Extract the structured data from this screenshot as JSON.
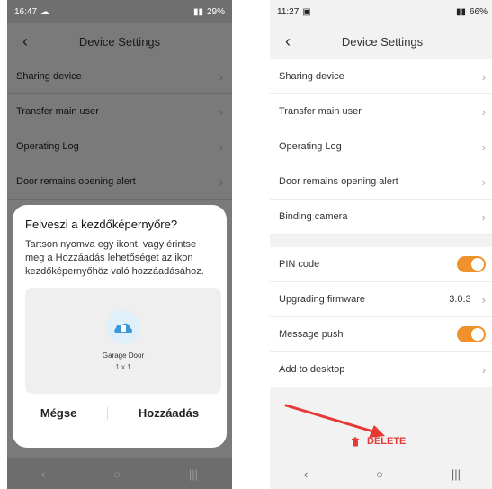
{
  "left": {
    "status": {
      "time": "16:47",
      "battery": "29%"
    },
    "header": {
      "title": "Device Settings"
    },
    "rows": [
      {
        "label": "Sharing device"
      },
      {
        "label": "Transfer main user"
      },
      {
        "label": "Operating Log"
      },
      {
        "label": "Door remains opening alert"
      }
    ],
    "dialog": {
      "title": "Felveszi a kezdőképernyőre?",
      "body": "Tartson nyomva egy ikont, vagy érintse meg a Hozzáadás lehetőséget az ikon kezdőképernyőhöz való hozzáadásához.",
      "preview_name": "Garage Door",
      "preview_size": "1 x 1",
      "cancel_label": "Mégse",
      "add_label": "Hozzáadás"
    }
  },
  "right": {
    "status": {
      "time": "11:27",
      "battery": "66%"
    },
    "header": {
      "title": "Device Settings"
    },
    "group1": [
      {
        "label": "Sharing device"
      },
      {
        "label": "Transfer main user"
      },
      {
        "label": "Operating Log"
      },
      {
        "label": "Door remains opening alert"
      },
      {
        "label": "Binding camera"
      }
    ],
    "pin": {
      "label": "PIN code",
      "enabled": true
    },
    "firmware": {
      "label": "Upgrading firmware",
      "version": "3.0.3"
    },
    "push": {
      "label": "Message push",
      "enabled": true
    },
    "desktop": {
      "label": "Add to desktop"
    },
    "delete_label": "DELETE"
  },
  "colors": {
    "accent": "#f0922b",
    "danger": "#e53935",
    "arrow": "#e53935"
  },
  "icons": {
    "back": "chevron-left-icon",
    "next": "chevron-right-icon",
    "delete": "trash-icon"
  }
}
